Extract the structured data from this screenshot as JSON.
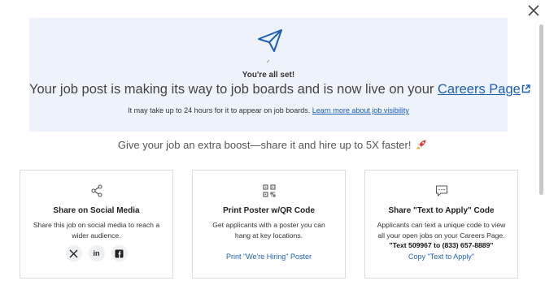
{
  "hero": {
    "status": "You're all set!",
    "headline_prefix": "Your job post is making its way to job boards and is now live on your",
    "careers_link": "Careers Page",
    "note_prefix": "It may take up to 24 hours for it to appear on job boards.",
    "note_link": "Learn more about job visibility"
  },
  "boost_text": "Give your job an extra boost—share it and hire up to 5X faster!",
  "cards": {
    "social": {
      "icon": "share-icon",
      "title": "Share on Social Media",
      "description": "Share this job on social media to reach a wider audience.",
      "buttons": [
        "x-icon",
        "linkedin-icon",
        "facebook-icon"
      ]
    },
    "poster": {
      "icon": "qr-code-icon",
      "title": "Print Poster w/QR Code",
      "description": "Get applicants with a poster you can hang at key locations.",
      "link": "Print \"We're Hiring\" Poster"
    },
    "text": {
      "icon": "chat-icon",
      "title": "Share \"Text to Apply\" Code",
      "description": "Applicants can text a unique code to view all your open jobs on your Careers Page.",
      "code": "\"Text 509967 to (833) 657-8889\"",
      "link": "Copy \"Text to Apply\""
    }
  },
  "colors": {
    "accent": "#1d5fb8",
    "hero_bg": "#eef2fb"
  }
}
